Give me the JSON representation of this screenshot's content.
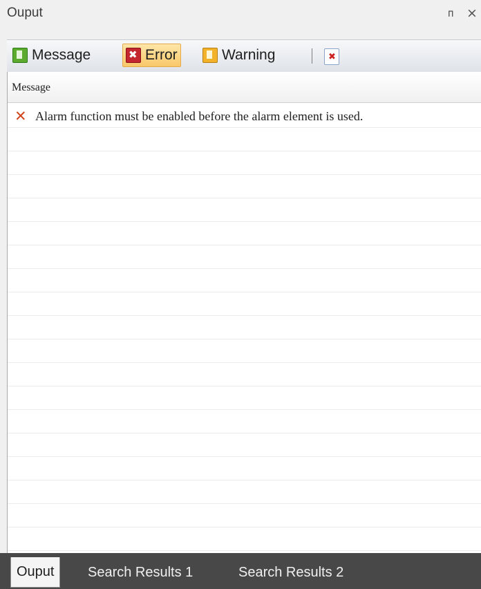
{
  "window": {
    "title": "Ouput",
    "pin_glyph": "ᴨ",
    "close_glyph": "×"
  },
  "toolbar": {
    "buttons": [
      {
        "label": "Message",
        "icon": "message-icon",
        "active": false
      },
      {
        "label": "Error",
        "icon": "error-icon",
        "active": true
      },
      {
        "label": "Warning",
        "icon": "warning-icon",
        "active": false
      }
    ],
    "clear_icon": "clear-output-icon"
  },
  "grid": {
    "columns": [
      "Message"
    ],
    "rows": [
      {
        "icon": "error-x-icon",
        "message": "Alarm function must be enabled before the alarm element is used."
      }
    ]
  },
  "tabs": [
    {
      "label": "Ouput",
      "active": true
    },
    {
      "label": "Search Results 1",
      "active": false
    },
    {
      "label": "Search Results 2",
      "active": false
    }
  ],
  "colors": {
    "active_button": "#f9c86a",
    "error_red": "#c4262f",
    "message_green": "#5cab2f",
    "warning_yellow": "#f2b22a",
    "tabbar_bg": "#484848"
  }
}
